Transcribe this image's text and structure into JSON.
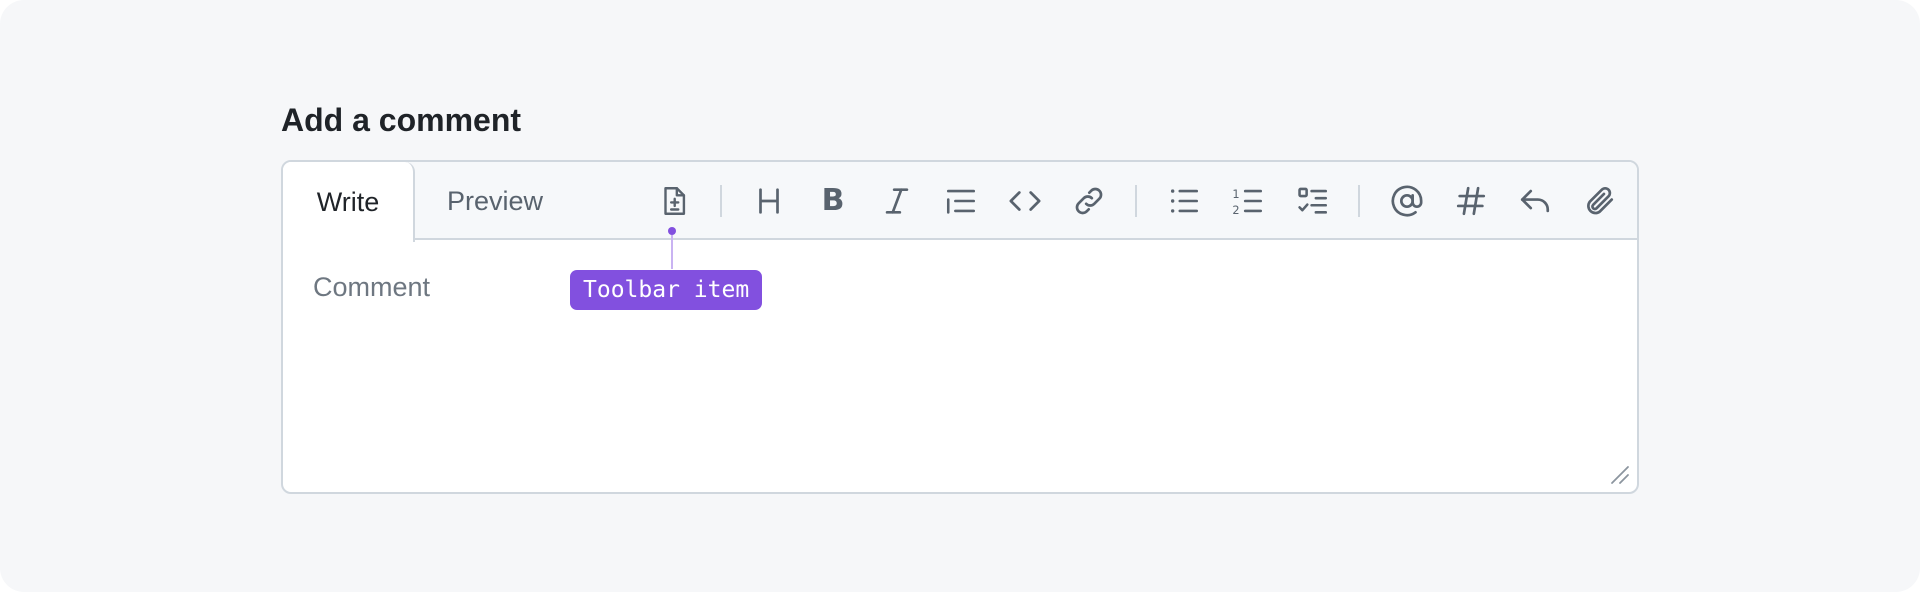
{
  "page": {
    "title": "Add a comment"
  },
  "tabs": {
    "write": "Write",
    "preview": "Preview"
  },
  "toolbar": {
    "items": [
      {
        "icon": "file-diff-icon",
        "label": ""
      },
      {
        "icon": "heading-icon",
        "label": "H"
      },
      {
        "icon": "bold-icon",
        "label": "B"
      },
      {
        "icon": "italic-icon",
        "label": ""
      },
      {
        "icon": "quote-icon",
        "label": ""
      },
      {
        "icon": "code-icon",
        "label": ""
      },
      {
        "icon": "link-icon",
        "label": ""
      },
      {
        "icon": "unordered-list-icon",
        "label": ""
      },
      {
        "icon": "ordered-list-icon",
        "label": ""
      },
      {
        "icon": "tasklist-icon",
        "label": ""
      },
      {
        "icon": "mention-icon",
        "label": ""
      },
      {
        "icon": "reference-icon",
        "label": ""
      },
      {
        "icon": "reply-icon",
        "label": ""
      },
      {
        "icon": "paperclip-icon",
        "label": ""
      }
    ],
    "ordered_list_numbers": [
      "1",
      "2"
    ]
  },
  "comment": {
    "placeholder": "Comment",
    "value": ""
  },
  "annotation": {
    "label": "Toolbar item"
  },
  "colors": {
    "accent": "#8250df",
    "icon": "#59636e",
    "border": "#d0d7de",
    "background": "#f6f7f9"
  }
}
